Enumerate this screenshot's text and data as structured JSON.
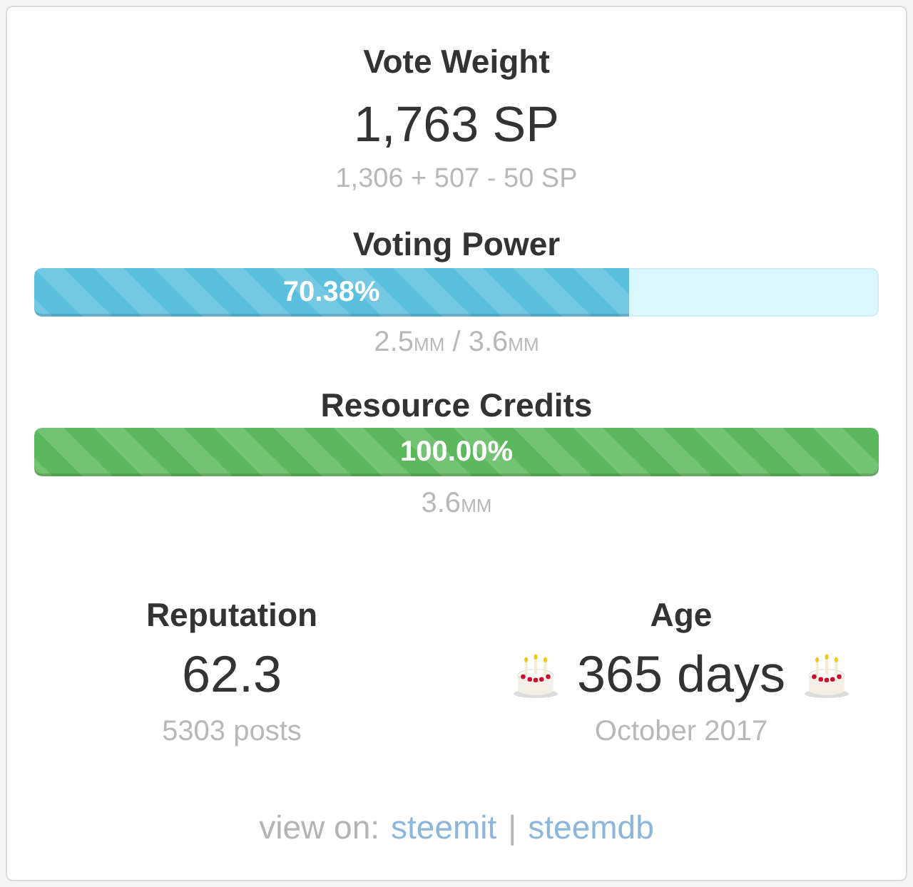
{
  "vote_weight": {
    "title": "Vote Weight",
    "value": "1,763 SP",
    "breakdown": "1,306 + 507 - 50 SP"
  },
  "meters": [
    {
      "kind": "info",
      "title": "Voting Power",
      "level": 0.7038,
      "label": "70.38%",
      "reading": [
        {
          "value": "2.5",
          "unit": "MM"
        },
        {
          "value": "3.6",
          "unit": "MM"
        }
      ],
      "reading_separator": "/"
    },
    {
      "kind": "success",
      "title": "Resource Credits",
      "level": 1,
      "label": "100.00%",
      "reading": [
        {
          "value": "3.6",
          "unit": "MM"
        }
      ]
    }
  ],
  "stats": [
    {
      "title": "Reputation",
      "value": "62.3",
      "note": "5303 posts",
      "cake_icons": false
    },
    {
      "title": "Age",
      "value": "365 days",
      "note": "October 2017",
      "cake_icons": true
    }
  ],
  "footer": {
    "prefix": "view on:",
    "links": [
      "steemit",
      "steemdb"
    ],
    "separator": "|"
  }
}
